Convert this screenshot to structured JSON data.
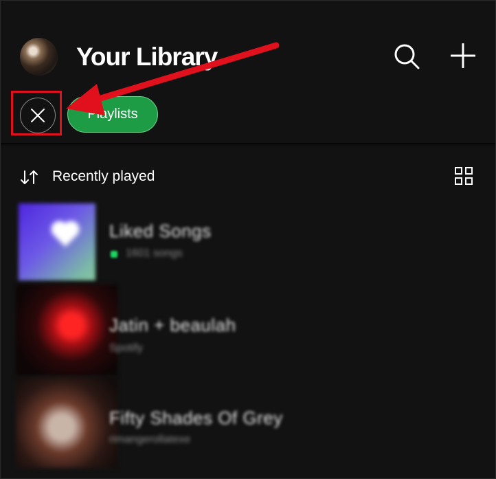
{
  "header": {
    "title": "Your Library",
    "avatar": "avatar",
    "icons": [
      "search-icon",
      "plus-icon"
    ]
  },
  "filters": {
    "close_icon": "close-icon",
    "chips": [
      "Playlists"
    ]
  },
  "sort": {
    "label": "Recently played",
    "sort_icon": "sort-icon",
    "view_icon": "grid-view-icon"
  },
  "items": [
    {
      "title": "Liked Songs",
      "subtitle": "1601 songs"
    },
    {
      "title": "Jatin + beaulah",
      "subtitle": "Spotify"
    },
    {
      "title": "Fifty Shades Of Grey",
      "subtitle": "rimangerollatexe"
    }
  ],
  "colors": {
    "background": "#121212",
    "accent_green": "#1d9b45",
    "annotation_red": "#e0101c"
  }
}
